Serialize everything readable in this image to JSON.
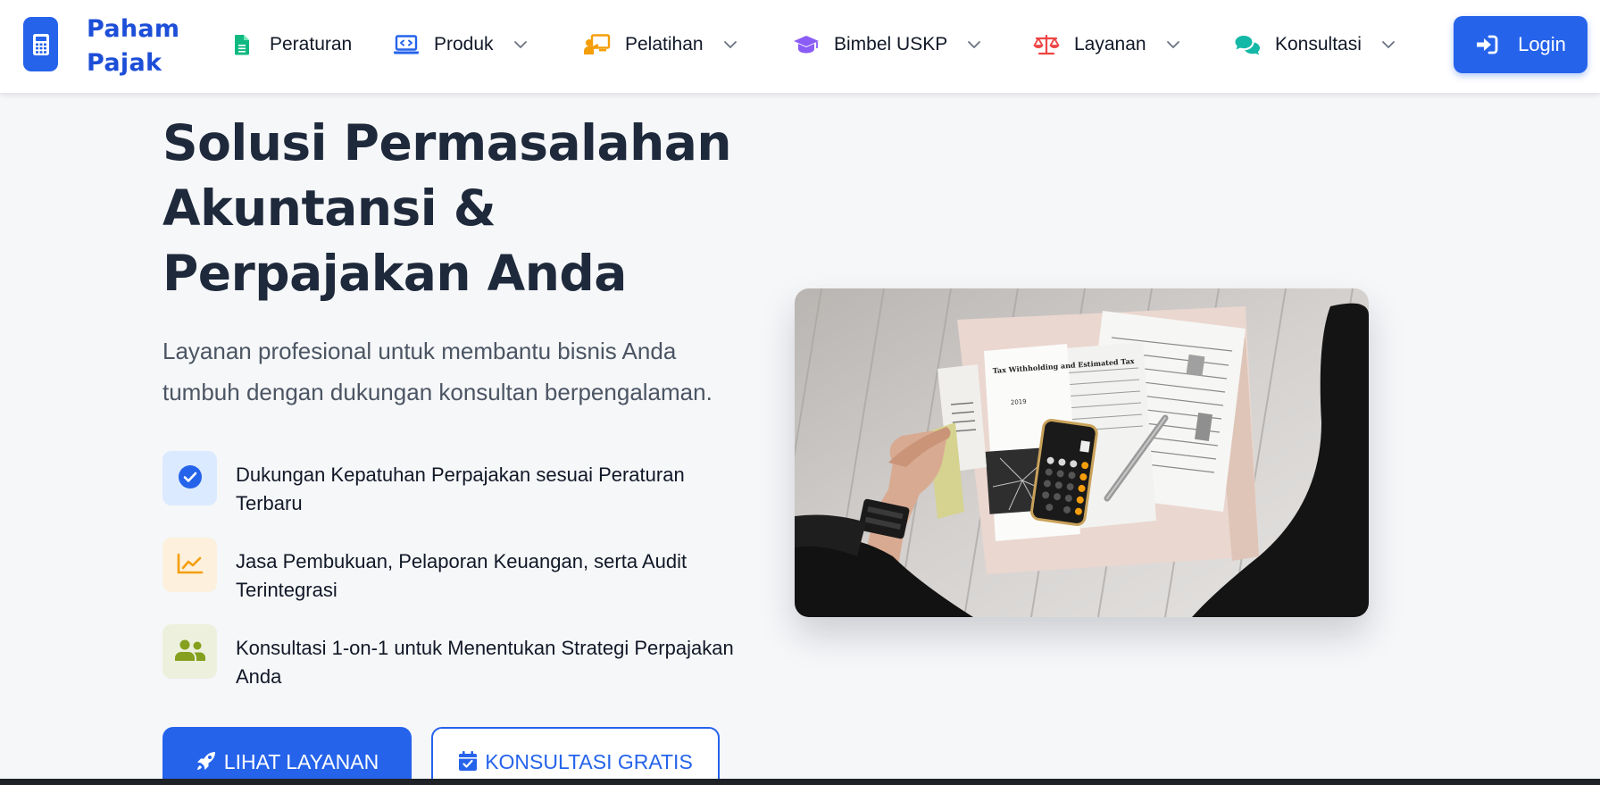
{
  "brand": {
    "name_line1": "Paham",
    "name_line2": "Pajak",
    "logo_icon": "calculator-icon",
    "color": "#2563eb"
  },
  "nav": {
    "items": [
      {
        "label": "Peraturan",
        "icon": "file-icon",
        "icon_color": "#10b981",
        "has_dropdown": false
      },
      {
        "label": "Produk",
        "icon": "laptop-code-icon",
        "icon_color": "#2563eb",
        "has_dropdown": true
      },
      {
        "label": "Pelatihan",
        "icon": "chalkboard-teacher-icon",
        "icon_color": "#f59e0b",
        "has_dropdown": true
      },
      {
        "label": "Bimbel USKP",
        "icon": "graduation-cap-icon",
        "icon_color": "#8b5cf6",
        "has_dropdown": true
      },
      {
        "label": "Layanan",
        "icon": "balance-scale-icon",
        "icon_color": "#ef4444",
        "has_dropdown": true
      },
      {
        "label": "Konsultasi",
        "icon": "comments-icon",
        "icon_color": "#14b8a6",
        "has_dropdown": true
      }
    ],
    "login_label": "Login"
  },
  "hero": {
    "title_line1": "Solusi Permasalahan",
    "title_line2": "Akuntansi &",
    "title_line3": "Perpajakan Anda",
    "subtitle": "Layanan profesional untuk membantu bisnis Anda tumbuh dengan dukungan konsultan berpengalaman.",
    "features": [
      {
        "text": "Dukungan Kepatuhan Perpajakan sesuai Peraturan Terbaru",
        "icon": "check-circle-icon",
        "icon_color": "#2563eb",
        "bg": "#dbeafe"
      },
      {
        "text": "Jasa Pembukuan, Pelaporan Keuangan, serta Audit Terintegrasi",
        "icon": "chart-line-icon",
        "icon_color": "#f59e0b",
        "bg": "#fdf0dc"
      },
      {
        "text": "Konsultasi 1-on-1 untuk Menentukan Strategi Perpajakan Anda",
        "icon": "users-icon",
        "icon_color": "#84a01e",
        "bg": "#ecf0dc"
      }
    ],
    "primary_button": "LIHAT LAYANAN",
    "secondary_button": "KONSULTASI GRATIS",
    "image_doc_title": "Tax Withholding and Estimated Tax",
    "image_doc_year": "2019"
  }
}
